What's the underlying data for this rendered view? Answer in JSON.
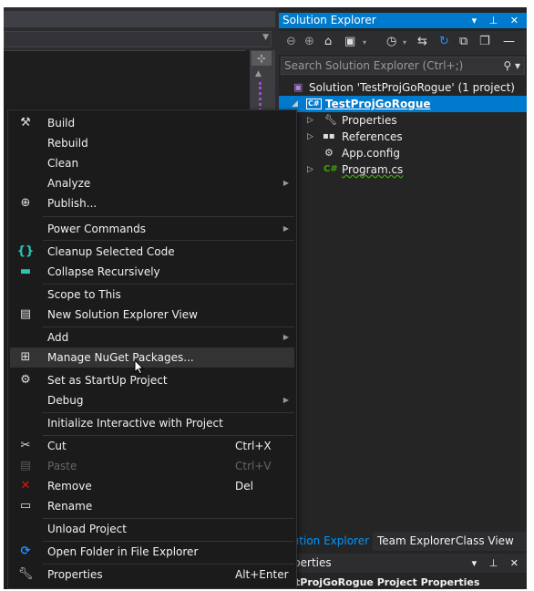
{
  "solution_explorer": {
    "title": "Solution Explorer",
    "title_controls": "▾ ⊥ ✕",
    "search_placeholder": "Search Solution Explorer (Ctrl+;)",
    "tree": {
      "solution": "Solution 'TestProjGoRogue' (1 project)",
      "project": "TestProjGoRogue",
      "items": [
        {
          "label": "Properties",
          "icon": "wrench-icon"
        },
        {
          "label": "References",
          "icon": "references-icon"
        },
        {
          "label": "App.config",
          "icon": "config-file-icon"
        },
        {
          "label": "Program.cs",
          "icon": "csharp-file-icon"
        }
      ]
    },
    "tabs": {
      "solution_explorer": "olution Explorer",
      "team_explorer": "Team Explorer",
      "class_view": "Class View"
    },
    "properties_panel": {
      "title": "roperties",
      "title_controls": "▾ ⊥ ✕",
      "subtitle": "estProjGoRogue  Project Properties"
    }
  },
  "context_menu": {
    "items": {
      "build": "Build",
      "rebuild": "Rebuild",
      "clean": "Clean",
      "analyze": "Analyze",
      "publish": "Publish...",
      "power_commands": "Power Commands",
      "cleanup_selected_code": "Cleanup Selected Code",
      "collapse_recursively": "Collapse Recursively",
      "scope_to_this": "Scope to This",
      "new_solution_explorer_view": "New Solution Explorer View",
      "add": "Add",
      "manage_nuget": "Manage NuGet Packages...",
      "set_startup": "Set as StartUp Project",
      "debug": "Debug",
      "initialize_interactive": "Initialize Interactive with Project",
      "cut": "Cut",
      "cut_shortcut": "Ctrl+X",
      "paste": "Paste",
      "paste_shortcut": "Ctrl+V",
      "remove": "Remove",
      "remove_shortcut": "Del",
      "rename": "Rename",
      "unload_project": "Unload Project",
      "open_folder": "Open Folder in File Explorer",
      "properties": "Properties",
      "properties_shortcut": "Alt+Enter"
    }
  },
  "colors": {
    "accent": "#007acc",
    "menu_bg": "#1b1b1c",
    "panel_bg": "#252526",
    "disabled_text": "#656565"
  }
}
